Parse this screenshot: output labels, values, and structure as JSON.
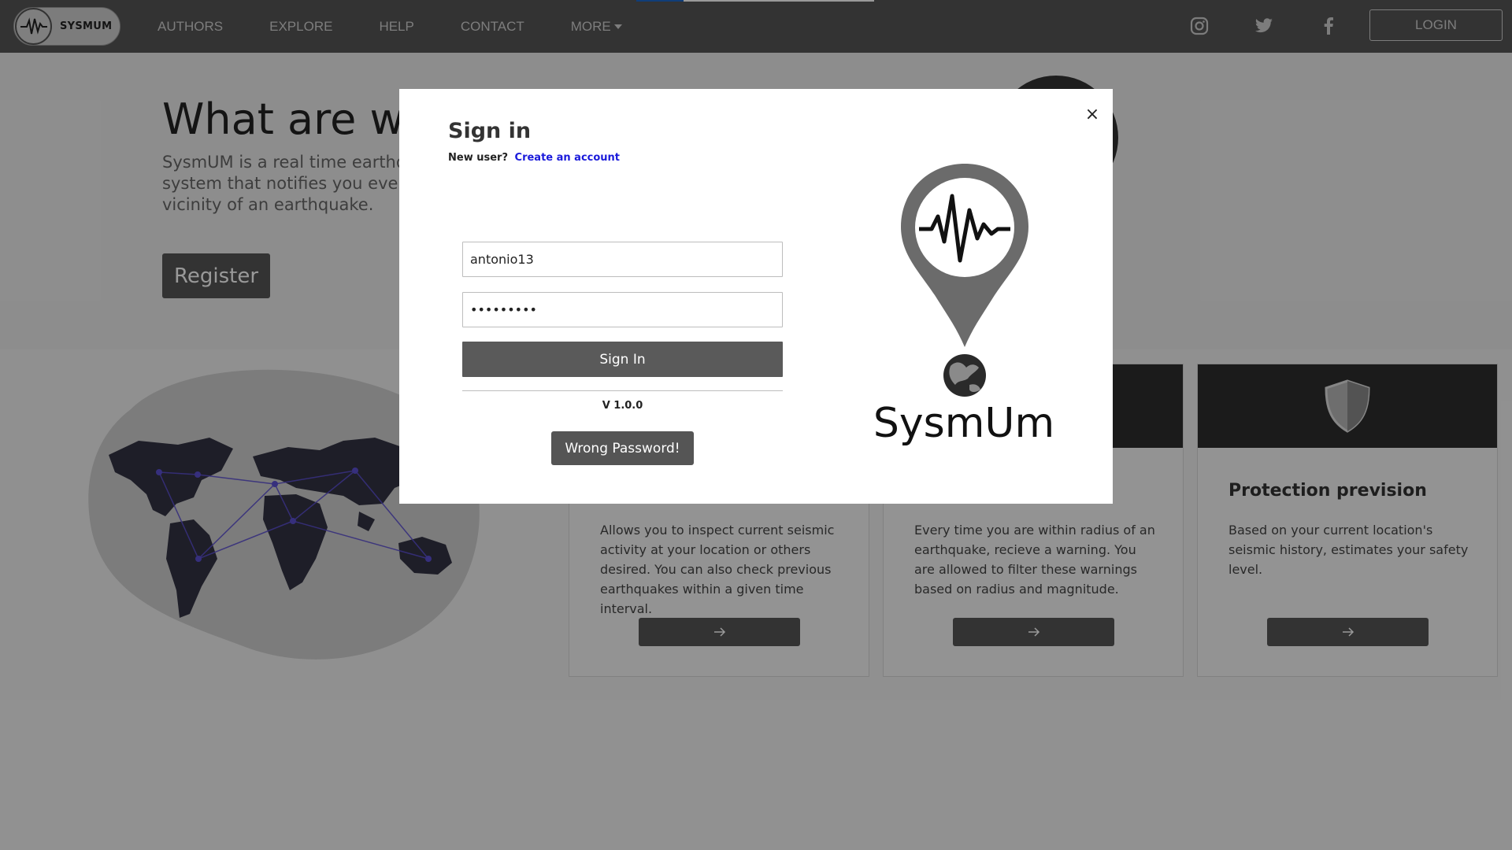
{
  "navbar": {
    "brand": "SYSMUM",
    "links": [
      {
        "label": "AUTHORS"
      },
      {
        "label": "EXPLORE"
      },
      {
        "label": "HELP"
      },
      {
        "label": "CONTACT"
      },
      {
        "label": "MORE"
      }
    ],
    "social": [
      "instagram-icon",
      "twitter-icon",
      "facebook-icon"
    ],
    "login_label": "LOGIN",
    "progress_percent": 20
  },
  "hero": {
    "title": "What are we",
    "description": "SysmUM is a real time earthqu system that notifies you every vicinity of an earthquake.",
    "register_label": "Register"
  },
  "cards": [
    {
      "title": "",
      "text": "Allows you to inspect current seismic activity at your location or others desired. You can also check previous earthquakes within a given time interval.",
      "arrow": "→"
    },
    {
      "title": "",
      "text": "Every time you are within radius of an earthquake, recieve a warning. You are allowed to filter these warnings based on radius and magnitude.",
      "arrow": "→"
    },
    {
      "title": "Protection prevision",
      "text": "Based on your current location's seismic history, estimates your safety level.",
      "arrow": "→"
    }
  ],
  "modal": {
    "title": "Sign in",
    "new_user_label": "New user?",
    "create_account_label": "Create an account",
    "username_value": "antonio13",
    "password_value": "antonio13",
    "sign_in_label": "Sign In",
    "version": "V 1.0.0",
    "wrong_password_label": "Wrong Password!",
    "logo_text": "SysmUm",
    "close_label": "×"
  },
  "colors": {
    "navbar": "#555555",
    "primary_button": "#555555",
    "link": "#1a1adb",
    "map_dots": "#5b4fd0"
  }
}
